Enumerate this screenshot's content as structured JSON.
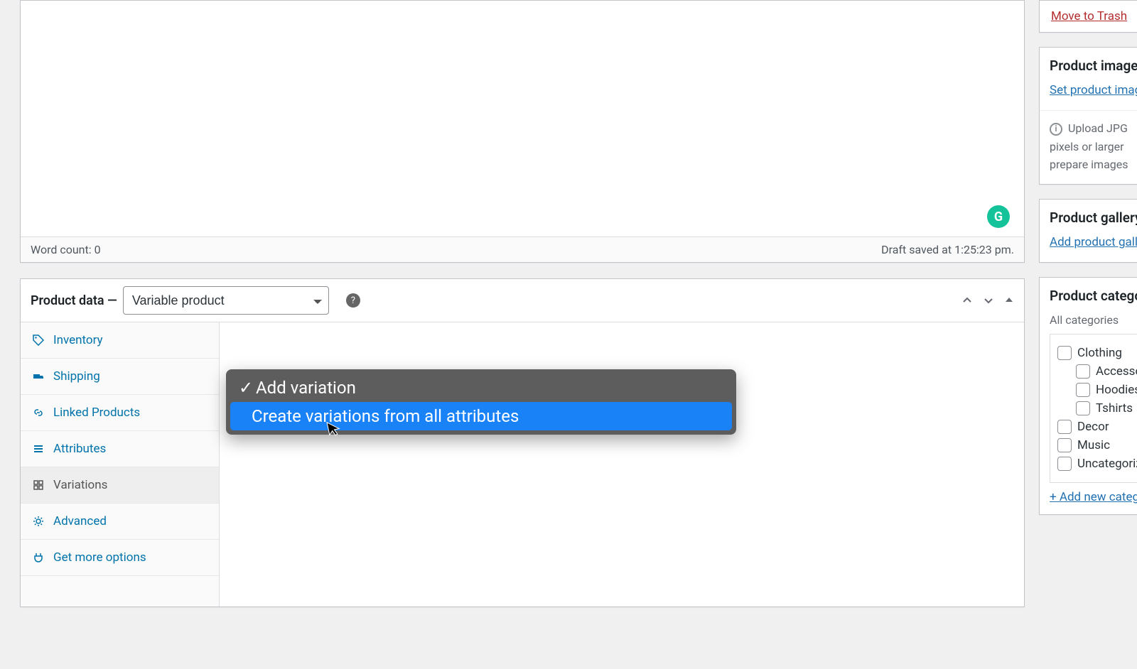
{
  "editor": {
    "word_count_label": "Word count: 0",
    "draft_saved": "Draft saved at 1:25:23 pm.",
    "grammarly": "G"
  },
  "product_data": {
    "title": "Product data —",
    "type_selected": "Variable product",
    "tabs": {
      "inventory": "Inventory",
      "shipping": "Shipping",
      "linked": "Linked Products",
      "attributes": "Attributes",
      "variations": "Variations",
      "advanced": "Advanced",
      "more": "Get more options"
    }
  },
  "variations_dropdown": {
    "option1_check": "✓",
    "option1": "Add variation",
    "option2": "Create variations from all attributes"
  },
  "sidebar": {
    "trash": "Move to Trash",
    "image_header": "Product image",
    "set_image": "Set product image",
    "image_hint1": "Upload JPG",
    "image_hint2": "pixels or larger",
    "image_hint3": "prepare images",
    "gallery_header": "Product gallery",
    "add_gallery": "Add product gallery",
    "categories_header": "Product categories",
    "all_cats": "All categories",
    "cats": {
      "clothing": "Clothing",
      "acc": "Accessories",
      "hood": "Hoodies",
      "tshirt": "Tshirts",
      "decor": "Decor",
      "music": "Music",
      "uncat": "Uncategorized"
    },
    "add_new_cat": "+ Add new category"
  }
}
